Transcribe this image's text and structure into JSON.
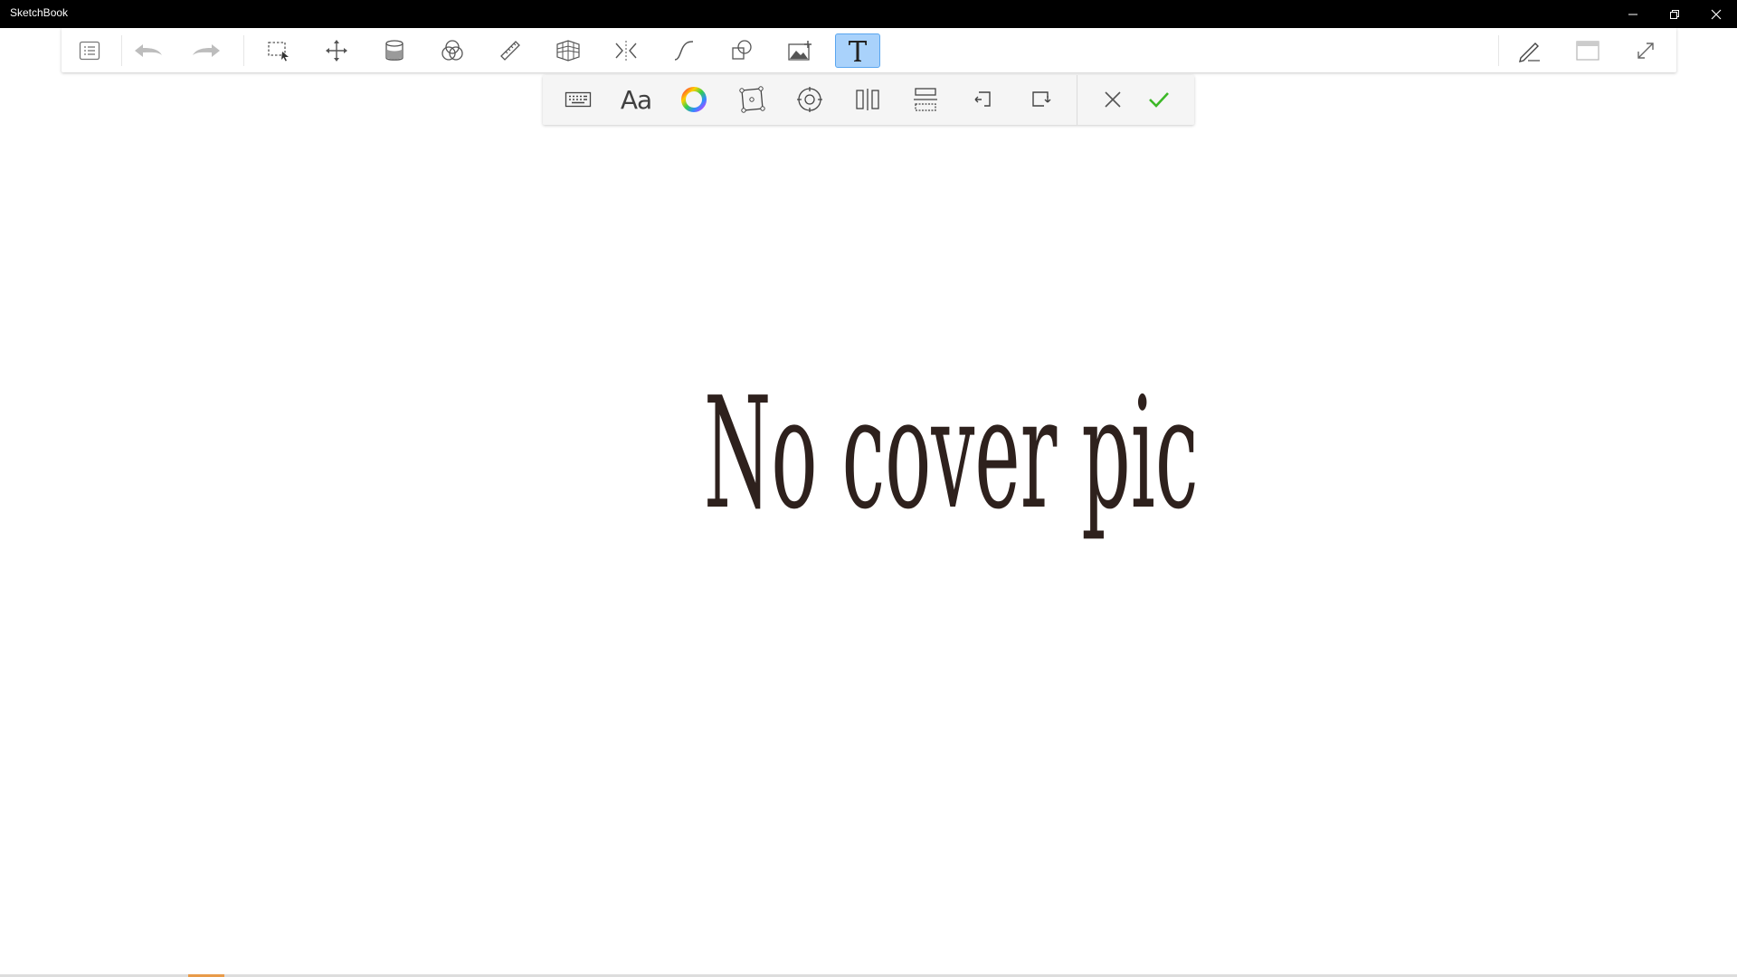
{
  "window": {
    "title": "SketchBook",
    "controls": [
      "minimize-icon",
      "restore-icon",
      "close-icon"
    ]
  },
  "main_toolbar": {
    "left_tools": [
      {
        "name": "menu",
        "icon": "list-icon"
      },
      {
        "name": "undo",
        "icon": "undo-arrow-icon"
      },
      {
        "name": "redo",
        "icon": "redo-arrow-icon"
      },
      {
        "name": "selection",
        "icon": "selection-icon"
      },
      {
        "name": "transform",
        "icon": "move-arrows-icon"
      },
      {
        "name": "fill",
        "icon": "paint-bucket-icon"
      },
      {
        "name": "blend",
        "icon": "blend-circles-icon"
      },
      {
        "name": "ruler",
        "icon": "ruler-icon"
      },
      {
        "name": "perspective",
        "icon": "perspective-grid-icon"
      },
      {
        "name": "symmetry",
        "icon": "symmetry-icon"
      },
      {
        "name": "curve",
        "icon": "curve-icon"
      },
      {
        "name": "shapes",
        "icon": "shapes-icon"
      },
      {
        "name": "add-image",
        "icon": "add-image-icon"
      },
      {
        "name": "text",
        "icon": "text-t-icon",
        "active": true
      }
    ],
    "right_tools": [
      {
        "name": "pen-mode",
        "icon": "pen-icon"
      },
      {
        "name": "ui-toggle",
        "icon": "window-icon"
      },
      {
        "name": "fullscreen",
        "icon": "expand-icon"
      }
    ],
    "active_color": "#a9d2fb"
  },
  "text_toolbar": {
    "font_label": "Aa",
    "tools": [
      "keyboard-icon",
      "font-icon",
      "color-wheel-icon",
      "transform-box-icon",
      "pivot-icon",
      "align-vertical-icon",
      "align-horizontal-icon",
      "rotate-left-icon",
      "rotate-right-icon",
      "cancel-icon",
      "confirm-icon"
    ],
    "confirm_color": "#3cb827"
  },
  "canvas": {
    "text": "No cover pic",
    "text_color": "#2e211d"
  }
}
